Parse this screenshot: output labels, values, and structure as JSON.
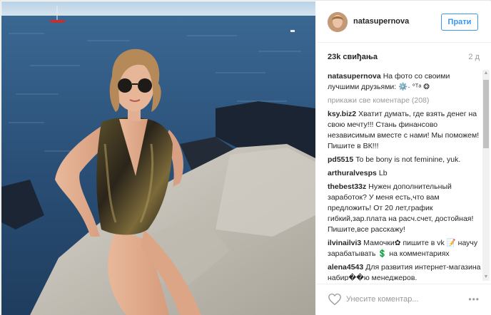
{
  "post": {
    "owner": "natasupernova",
    "follow_label": "Прати",
    "likes": "23k свиђања",
    "time": "2 д",
    "comments": [
      {
        "user": "natasupernova",
        "text": "На фото со своими лучшими друзьями: ⚙️· °ᵀᵃ ❂"
      },
      {
        "type": "more",
        "text": "прикажи све коментаре (208)"
      },
      {
        "user": "ksy.biz2",
        "text": "Хватит думать, где взять денег на свою мечту!!! Стань финансово независимым вместе с нами! Мы поможем! Пишите в ВК!!!"
      },
      {
        "user": "pd5515",
        "text": "To be bony is not feminine, yuk."
      },
      {
        "user": "arthuralvesps",
        "text": "Lb"
      },
      {
        "user": "thebest33z",
        "text": "Нужен дополнительный заработок? У меня есть,что вам предложить! От 20 лет,график гибкий,зар.плата на расч.счет, достойная! Пишите,все расскажу!"
      },
      {
        "user": "ilvinailvi3",
        "text": "Мамочки✿ пишите в vk 📝 научу зарабатывать 💲 на комментариях"
      },
      {
        "user": "alena4543",
        "text": "Для развития интернет-магазина набир��ю менеджеров."
      }
    ],
    "comment_placeholder": "Унесите коментар...",
    "more_options": "•••"
  },
  "colors": {
    "accent": "#3897f0",
    "text": "#262626",
    "muted": "#999999",
    "sea": "#2f5680",
    "rock": "#c9c5bd"
  },
  "icons": {
    "heart": "heart-outline-icon",
    "scroll_up": "scroll-up-arrow-icon",
    "scroll_down": "scroll-down-arrow-icon"
  }
}
